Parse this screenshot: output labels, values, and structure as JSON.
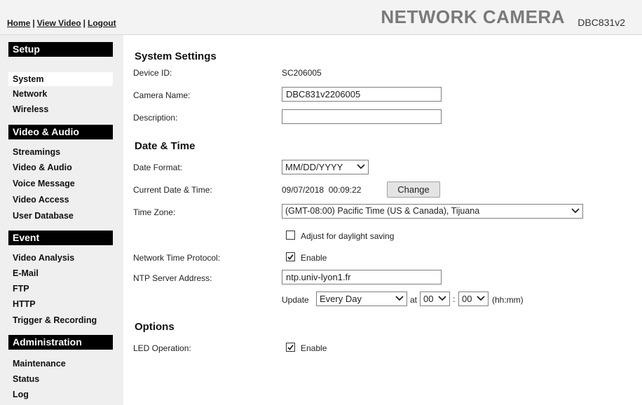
{
  "header": {
    "nav": [
      "Home",
      "View Video",
      "Logout"
    ],
    "separator": "|",
    "brand": "NETWORK CAMERA",
    "model": "DBC831v2"
  },
  "sidebar": {
    "setup": {
      "title": "Setup",
      "items": [
        "System",
        "Network",
        "Wireless"
      ]
    },
    "video_audio": {
      "title": "Video & Audio",
      "items": [
        "Streamings",
        "Video & Audio",
        "Voice Message",
        "Video Access",
        "User Database"
      ]
    },
    "event": {
      "title": "Event",
      "items": [
        "Video Analysis",
        "E-Mail",
        "FTP",
        "HTTP",
        "Trigger & Recording"
      ]
    },
    "administration": {
      "title": "Administration",
      "items": [
        "Maintenance",
        "Status",
        "Log"
      ]
    },
    "active_item": "System"
  },
  "system_settings": {
    "title": "System Settings",
    "device_id_label": "Device ID:",
    "device_id_value": "SC206005",
    "camera_name_label": "Camera Name:",
    "camera_name_value": "DBC831v2206005",
    "description_label": "Description:",
    "description_value": ""
  },
  "date_time": {
    "title": "Date & Time",
    "date_format_label": "Date Format:",
    "date_format_value": "MM/DD/YYYY",
    "current_label": "Current Date & Time:",
    "current_value": "09/07/2018  00:09:22",
    "change_button": "Change",
    "time_zone_label": "Time Zone:",
    "time_zone_value": "(GMT-08:00) Pacific Time (US & Canada), Tijuana",
    "dst_label": "Adjust for daylight saving",
    "dst_checked": false,
    "ntp_label": "Network Time Protocol:",
    "ntp_enable_label": "Enable",
    "ntp_checked": true,
    "ntp_server_label": "NTP Server Address:",
    "ntp_server_value": "ntp.univ-lyon1.fr",
    "update_label": "Update",
    "update_frequency": "Every Day",
    "at_label": "at",
    "hour": "00",
    "colon": ":",
    "minute": "00",
    "time_format_hint": "(hh:mm)"
  },
  "options": {
    "title": "Options",
    "led_label": "LED Operation:",
    "led_enable_label": "Enable",
    "led_checked": true
  }
}
